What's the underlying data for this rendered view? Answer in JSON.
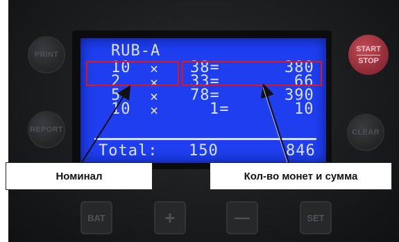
{
  "buttons": {
    "print": "PRINT",
    "report": "REPORT",
    "start": "START",
    "stop": "STOP",
    "clear": "CLEAR",
    "bat": "BAT",
    "plus": "+",
    "minus": "—",
    "set": "SET"
  },
  "display": {
    "currency": "RUB-A",
    "rows": [
      {
        "denomination": "10",
        "op": "×",
        "count": "38=",
        "sum": "380"
      },
      {
        "denomination": "2",
        "op": "×",
        "count": "33=",
        "sum": "66"
      },
      {
        "denomination": "5",
        "op": "×",
        "count": "78=",
        "sum": "390"
      },
      {
        "denomination": "10",
        "op": "×",
        "count": "1=",
        "sum": "10"
      }
    ],
    "total_label": "Total:",
    "total_count": "150",
    "total_sum": "846"
  },
  "annotations": {
    "left_label": "Номинал",
    "right_label": "Кол-во монет и сумма",
    "highlight_color": "#e01818"
  }
}
